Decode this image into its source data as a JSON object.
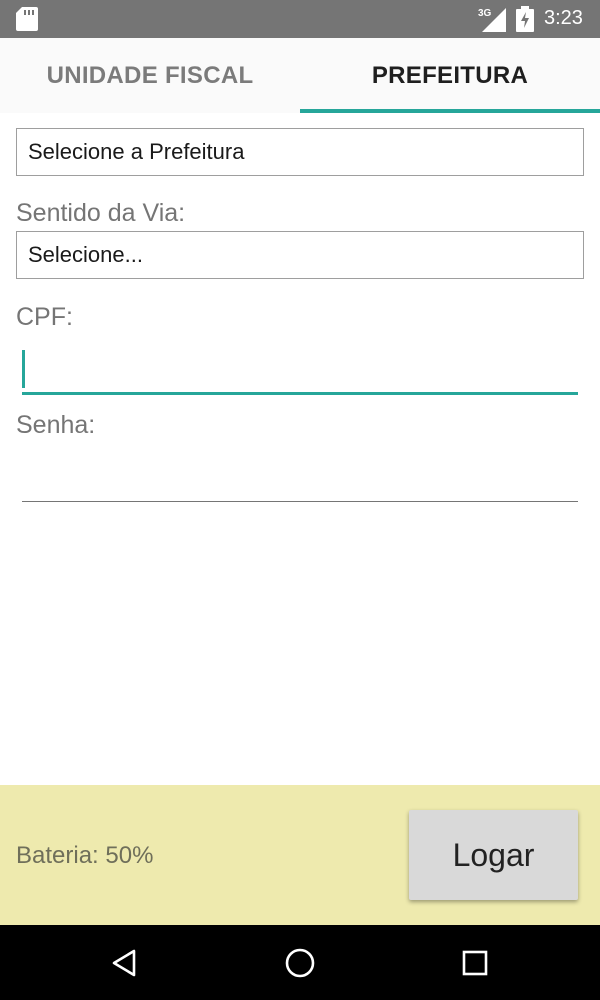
{
  "status_bar": {
    "time": "3:23",
    "network_label": "3G",
    "icons": [
      "sd-card-icon",
      "signal-icon",
      "battery-icon"
    ]
  },
  "tabs": [
    {
      "label": "UNIDADE FISCAL",
      "selected": false
    },
    {
      "label": "PREFEITURA",
      "selected": true
    }
  ],
  "form": {
    "prefeitura_spinner": {
      "value": "Selecione a Prefeitura"
    },
    "sentido_label": "Sentido da Via:",
    "sentido_spinner": {
      "value": "Selecione..."
    },
    "cpf_label": "CPF:",
    "cpf_value": "",
    "senha_label": "Senha:",
    "senha_value": ""
  },
  "footer": {
    "battery_text": "Bateria: 50%",
    "login_button": "Logar"
  },
  "nav_bar": {
    "icons": [
      "back-icon",
      "home-icon",
      "recents-icon"
    ]
  },
  "colors": {
    "accent": "#26a69a",
    "status_bar": "#757575",
    "footer_bg": "#eeeaae",
    "button_bg": "#d9d9d9"
  }
}
